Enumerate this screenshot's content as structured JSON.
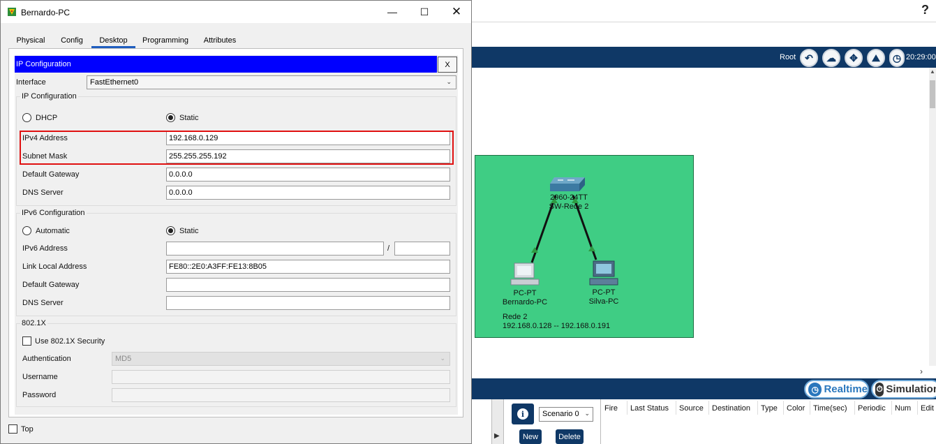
{
  "dialog": {
    "title": "Bernardo-PC",
    "tabs": [
      "Physical",
      "Config",
      "Desktop",
      "Programming",
      "Attributes"
    ],
    "active_tab": "Desktop",
    "app_header": "IP Configuration",
    "close_label": "X",
    "interface_label": "Interface",
    "interface_value": "FastEthernet0",
    "ipv4": {
      "group_title": "IP Configuration",
      "dhcp_label": "DHCP",
      "static_label": "Static",
      "mode": "Static",
      "ipv4_label": "IPv4 Address",
      "ipv4_value": "192.168.0.129",
      "mask_label": "Subnet Mask",
      "mask_value": "255.255.255.192",
      "gateway_label": "Default Gateway",
      "gateway_value": "0.0.0.0",
      "dns_label": "DNS Server",
      "dns_value": "0.0.0.0"
    },
    "ipv6": {
      "group_title": "IPv6 Configuration",
      "auto_label": "Automatic",
      "static_label": "Static",
      "mode": "Static",
      "addr_label": "IPv6 Address",
      "addr_value": "",
      "slash": "/",
      "prefix_value": "",
      "link_local_label": "Link Local Address",
      "link_local_value": "FE80::2E0:A3FF:FE13:8B05",
      "gateway_label": "Default Gateway",
      "gateway_value": "",
      "dns_label": "DNS Server",
      "dns_value": ""
    },
    "dot1x": {
      "group_title": "802.1X",
      "use_label": "Use 802.1X Security",
      "auth_label": "Authentication",
      "auth_value": "MD5",
      "username_label": "Username",
      "username_value": "",
      "password_label": "Password",
      "password_value": ""
    },
    "top_label": "Top"
  },
  "workspace": {
    "help": "?",
    "root_label": "Root",
    "clock": "20:29:00",
    "switch": {
      "model": "2960-24TT",
      "name": "SW-Rede 2"
    },
    "pc1": {
      "model": "PC-PT",
      "name": "Bernardo-PC"
    },
    "pc2": {
      "model": "PC-PT",
      "name": "Silva-PC"
    },
    "cluster_name": "Rede 2",
    "cluster_range": "192.168.0.128 -- 192.168.0.191",
    "cluster_color": "#3fcd84",
    "realtime_label": "Realtime",
    "simulation_label": "Simulation",
    "scenario_value": "Scenario 0",
    "new_label": "New",
    "delete_label": "Delete",
    "pdu_headers": [
      "Fire",
      "Last Status",
      "Source",
      "Destination",
      "Type",
      "Color",
      "Time(sec)",
      "Periodic",
      "Num",
      "Edit"
    ]
  },
  "colors": {
    "header_blue": "#0000ff",
    "highlight_red": "#e01010",
    "toolbar_navy": "#0f3866"
  }
}
